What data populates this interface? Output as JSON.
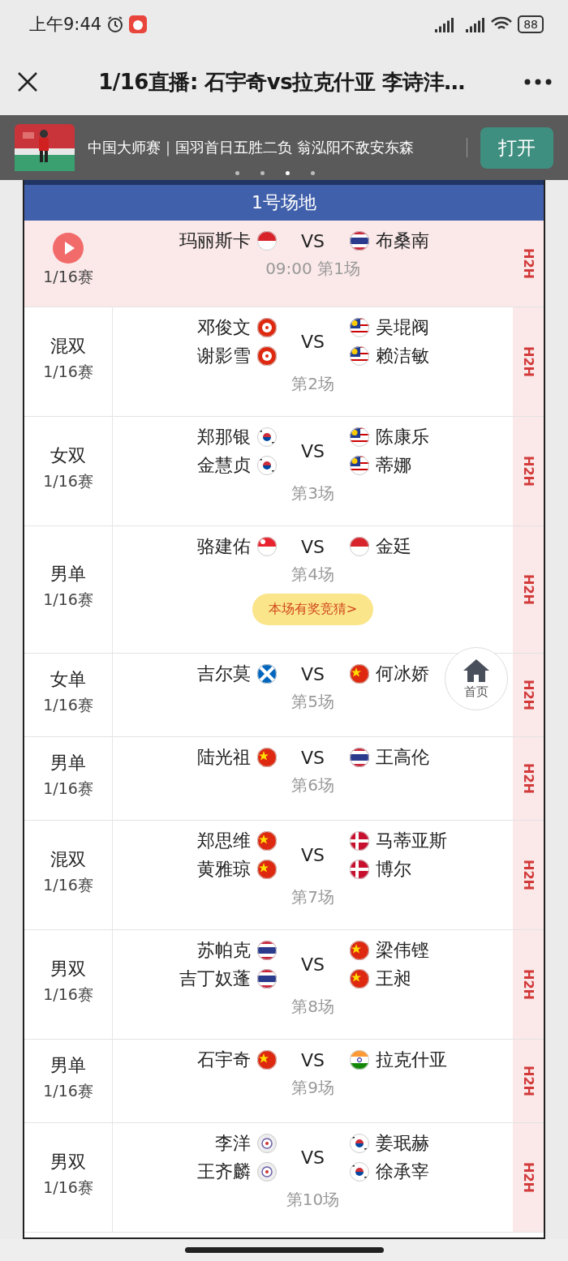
{
  "status_bar": {
    "time": "上午9:44",
    "battery": "88"
  },
  "title_bar": {
    "title": "1/16直播: 石宇奇vs拉克什亚 李诗沣…"
  },
  "banner": {
    "headline": "中国大师赛｜国羽首日五胜二负 翁泓阳不敌安东森",
    "button": "打开",
    "dots": [
      {
        "selected": false
      },
      {
        "selected": false
      },
      {
        "selected": true
      },
      {
        "selected": false
      }
    ]
  },
  "court": {
    "title": "1号场地"
  },
  "matches": [
    {
      "live": true,
      "date": "1/16赛",
      "left": [
        {
          "name": "玛丽斯卡",
          "kind": "id"
        }
      ],
      "right": [
        {
          "name": "布桑南",
          "kind": "th"
        }
      ],
      "vs": "VS",
      "info": "09:00 第1场",
      "h2h": "H2H"
    },
    {
      "live": false,
      "event": "混双",
      "date": "1/16赛",
      "left": [
        {
          "name": "邓俊文",
          "kind": "hk"
        },
        {
          "name": "谢影雪",
          "kind": "hk"
        }
      ],
      "right": [
        {
          "name": "吴堒阀",
          "kind": "my"
        },
        {
          "name": "赖洁敏",
          "kind": "my"
        }
      ],
      "vs": "VS",
      "info": "第2场",
      "h2h": "H2H"
    },
    {
      "live": false,
      "event": "女双",
      "date": "1/16赛",
      "left": [
        {
          "name": "郑那银",
          "kind": "kr"
        },
        {
          "name": "金慧贞",
          "kind": "kr"
        }
      ],
      "right": [
        {
          "name": "陈康乐",
          "kind": "my"
        },
        {
          "name": "蒂娜",
          "kind": "my"
        }
      ],
      "vs": "VS",
      "info": "第3场",
      "h2h": "H2H"
    },
    {
      "live": false,
      "event": "男单",
      "date": "1/16赛",
      "left": [
        {
          "name": "骆建佑",
          "kind": "sg"
        }
      ],
      "right": [
        {
          "name": "金廷",
          "kind": "id"
        }
      ],
      "vs": "VS",
      "info": "第4场",
      "promo": "本场有奖竞猜>",
      "h2h": "H2H"
    },
    {
      "live": false,
      "event": "女单",
      "date": "1/16赛",
      "left": [
        {
          "name": "吉尔莫",
          "kind": "sco"
        }
      ],
      "right": [
        {
          "name": "何冰娇",
          "kind": "cn"
        }
      ],
      "vs": "VS",
      "info": "第5场",
      "h2h": "H2H"
    },
    {
      "live": false,
      "event": "男单",
      "date": "1/16赛",
      "left": [
        {
          "name": "陆光祖",
          "kind": "cn"
        }
      ],
      "right": [
        {
          "name": "王高伦",
          "kind": "th"
        }
      ],
      "vs": "VS",
      "info": "第6场",
      "h2h": "H2H"
    },
    {
      "live": false,
      "event": "混双",
      "date": "1/16赛",
      "left": [
        {
          "name": "郑思维",
          "kind": "cn"
        },
        {
          "name": "黄雅琼",
          "kind": "cn"
        }
      ],
      "right": [
        {
          "name": "马蒂亚斯",
          "kind": "dk"
        },
        {
          "name": "博尔",
          "kind": "dk"
        }
      ],
      "vs": "VS",
      "info": "第7场",
      "h2h": "H2H"
    },
    {
      "live": false,
      "event": "男双",
      "date": "1/16赛",
      "left": [
        {
          "name": "苏帕克",
          "kind": "th"
        },
        {
          "name": "吉丁奴蓬",
          "kind": "th"
        }
      ],
      "right": [
        {
          "name": "梁伟铿",
          "kind": "cn"
        },
        {
          "name": "王昶",
          "kind": "cn"
        }
      ],
      "vs": "VS",
      "info": "第8场",
      "h2h": "H2H"
    },
    {
      "live": false,
      "event": "男单",
      "date": "1/16赛",
      "left": [
        {
          "name": "石宇奇",
          "kind": "cn"
        }
      ],
      "right": [
        {
          "name": "拉克什亚",
          "kind": "in"
        }
      ],
      "vs": "VS",
      "info": "第9场",
      "h2h": "H2H"
    },
    {
      "live": false,
      "event": "男双",
      "date": "1/16赛",
      "left": [
        {
          "name": "李洋",
          "kind": "tpe"
        },
        {
          "name": "王齐麟",
          "kind": "tpe"
        }
      ],
      "right": [
        {
          "name": "姜珉赫",
          "kind": "kr"
        },
        {
          "name": "徐承宰",
          "kind": "kr"
        }
      ],
      "vs": "VS",
      "info": "第10场",
      "h2h": "H2H"
    }
  ],
  "home_button": {
    "label": "首页"
  }
}
